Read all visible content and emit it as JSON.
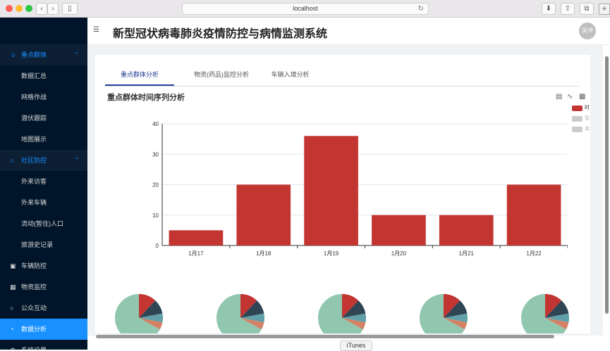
{
  "browser": {
    "url": "localhost",
    "bottom_tab": "iTunes"
  },
  "header": {
    "title": "新型冠状病毒肺炎疫情防控与病情监测系统",
    "avatar_text": "吴冲"
  },
  "sidebar": {
    "groups": [
      {
        "label": "重点群体",
        "items": [
          "数据汇总",
          "网格作战",
          "潜伏跟踪",
          "地图展示"
        ]
      },
      {
        "label": "社区防控",
        "items": [
          "外来访客",
          "外来车辆",
          "流动(暂住)人口",
          "旅游史记录"
        ]
      }
    ],
    "menu": [
      {
        "label": "车辆防控",
        "icon": "car-icon"
      },
      {
        "label": "物资监控",
        "icon": "gift-icon"
      },
      {
        "label": "公众互动",
        "icon": "chat-icon"
      },
      {
        "label": "数据分析",
        "icon": "pie-chart-icon",
        "active": true
      },
      {
        "label": "系统设置",
        "icon": "settings-icon"
      }
    ],
    "accent": "#1890ff"
  },
  "tabs": [
    {
      "label": "重点群体分析",
      "active": true
    },
    {
      "label": "物资(药品)监控分析"
    },
    {
      "label": "车辆入境分析"
    }
  ],
  "legend": [
    {
      "label": "时",
      "color": "#c23531"
    },
    {
      "label": "管",
      "color": "#cccccc"
    },
    {
      "label": "束",
      "color": "#cccccc"
    }
  ],
  "chart_data": [
    {
      "type": "bar",
      "title": "重点群体时间序列分析",
      "categories": [
        "1月17",
        "1月18",
        "1月19",
        "1月20",
        "1月21",
        "1月22"
      ],
      "values": [
        5,
        20,
        36,
        10,
        10,
        20
      ],
      "ylim": [
        0,
        40
      ],
      "yticks": [
        0,
        10,
        20,
        30,
        40
      ],
      "color": "#c23531",
      "grid": true
    },
    {
      "type": "pie",
      "count": 5,
      "colors": [
        "#c23531",
        "#2f4554",
        "#61a0a8",
        "#d48265",
        "#91c7ae"
      ],
      "values": [
        12,
        10,
        6,
        5,
        67
      ]
    }
  ]
}
